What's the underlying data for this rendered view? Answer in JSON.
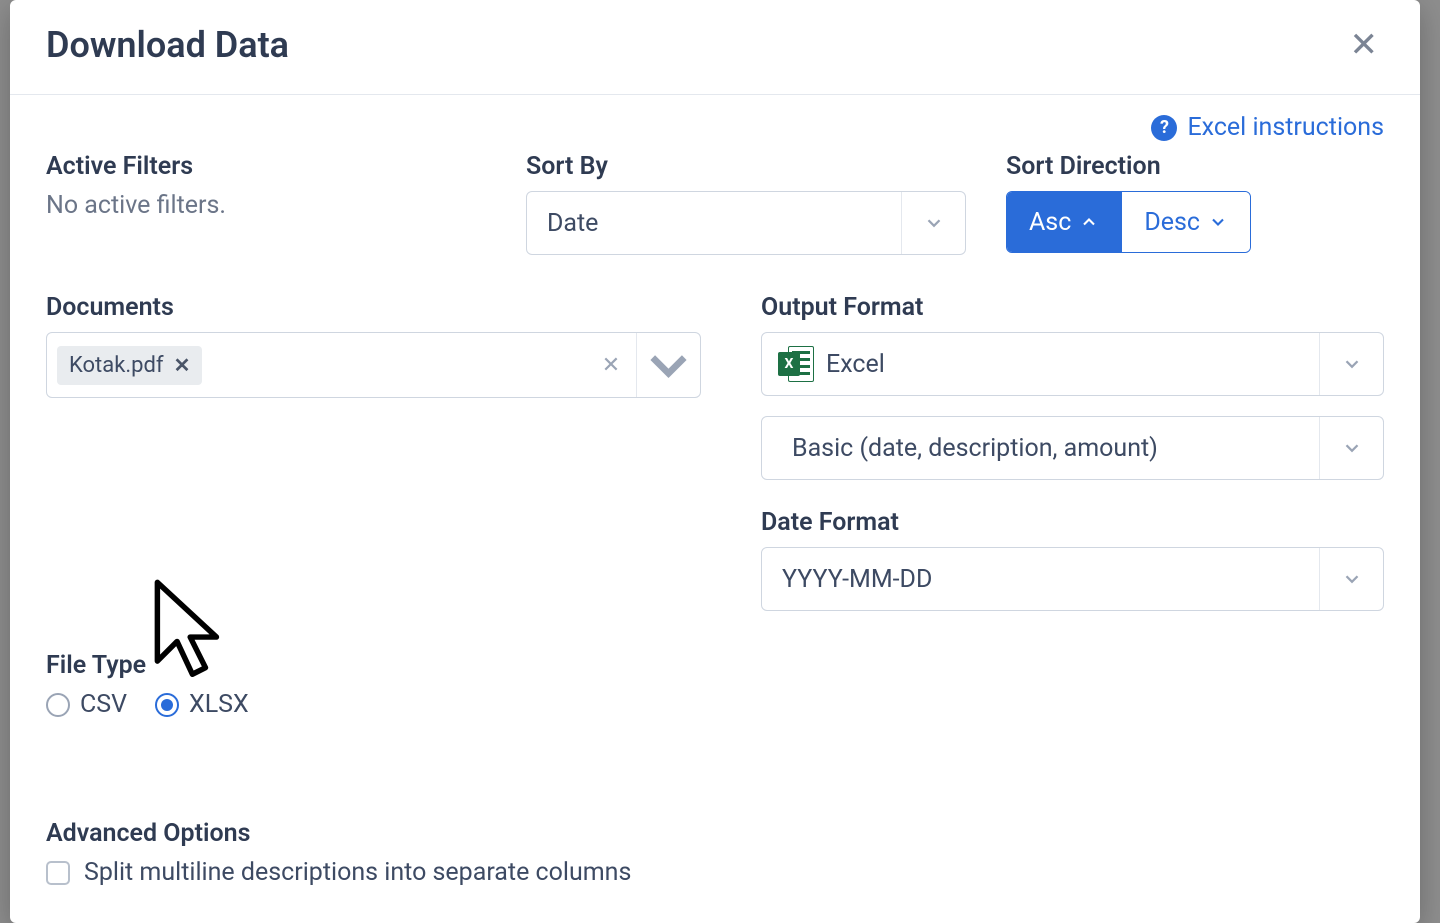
{
  "modal": {
    "title": "Download Data",
    "help_link": "Excel instructions"
  },
  "active_filters": {
    "label": "Active Filters",
    "status": "No active filters."
  },
  "sort_by": {
    "label": "Sort By",
    "value": "Date"
  },
  "sort_direction": {
    "label": "Sort Direction",
    "asc": "Asc",
    "desc": "Desc"
  },
  "documents": {
    "label": "Documents",
    "chip": "Kotak.pdf"
  },
  "output_format": {
    "label": "Output Format",
    "value": "Excel",
    "preset": "Basic (date, description, amount)"
  },
  "date_format": {
    "label": "Date Format",
    "value": "YYYY-MM-DD"
  },
  "file_type": {
    "label": "File Type",
    "csv": "CSV",
    "xlsx": "XLSX"
  },
  "advanced": {
    "label": "Advanced Options",
    "split_multiline": "Split multiline descriptions into separate columns"
  }
}
